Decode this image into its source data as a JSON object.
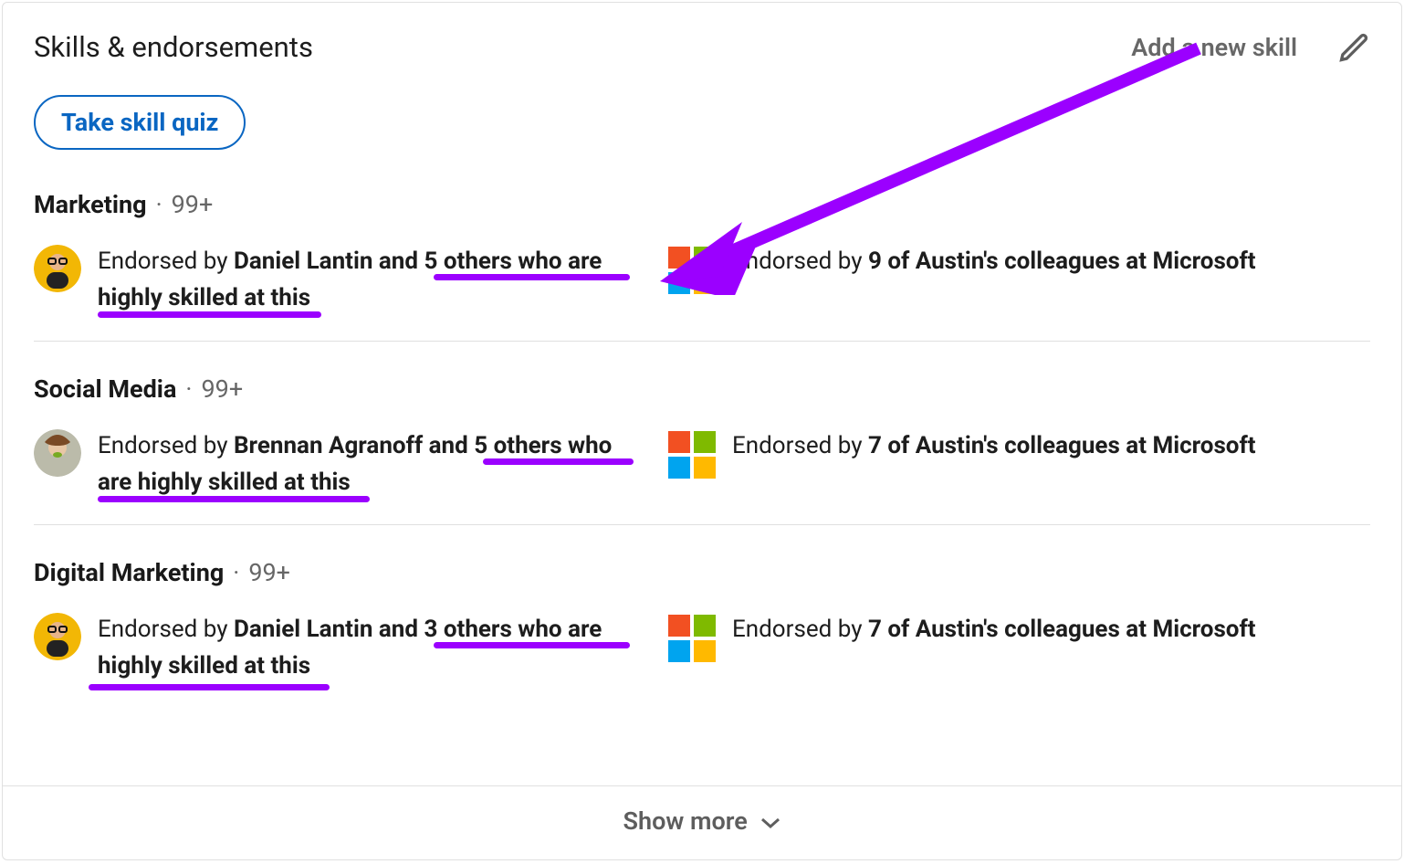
{
  "header": {
    "title": "Skills & endorsements",
    "add_label": "Add a new skill"
  },
  "quiz_button": "Take skill quiz",
  "footer": {
    "label": "Show more"
  },
  "skills": [
    {
      "name": "Marketing",
      "count": "99+",
      "left": {
        "prefix": "Endorsed by ",
        "bold": "Daniel Lantin and 5 others who are highly skilled at this"
      },
      "right": {
        "prefix": "Endorsed by ",
        "bold": "9 of Austin's colleagues at Microsoft"
      }
    },
    {
      "name": "Social Media",
      "count": "99+",
      "left": {
        "prefix": "Endorsed by ",
        "bold": "Brennan Agranoff and 5 others who are highly skilled at this"
      },
      "right": {
        "prefix": "Endorsed by ",
        "bold": "7 of Austin's colleagues at Microsoft"
      }
    },
    {
      "name": "Digital Marketing",
      "count": "99+",
      "left": {
        "prefix": "Endorsed by ",
        "bold": "Daniel Lantin and 3 others who are highly skilled at this"
      },
      "right": {
        "prefix": "Endorsed by ",
        "bold": "7 of Austin's colleagues at Microsoft"
      }
    }
  ],
  "annotation": {
    "arrow_color": "#9b00ff",
    "underline_color": "#9b00ff"
  }
}
